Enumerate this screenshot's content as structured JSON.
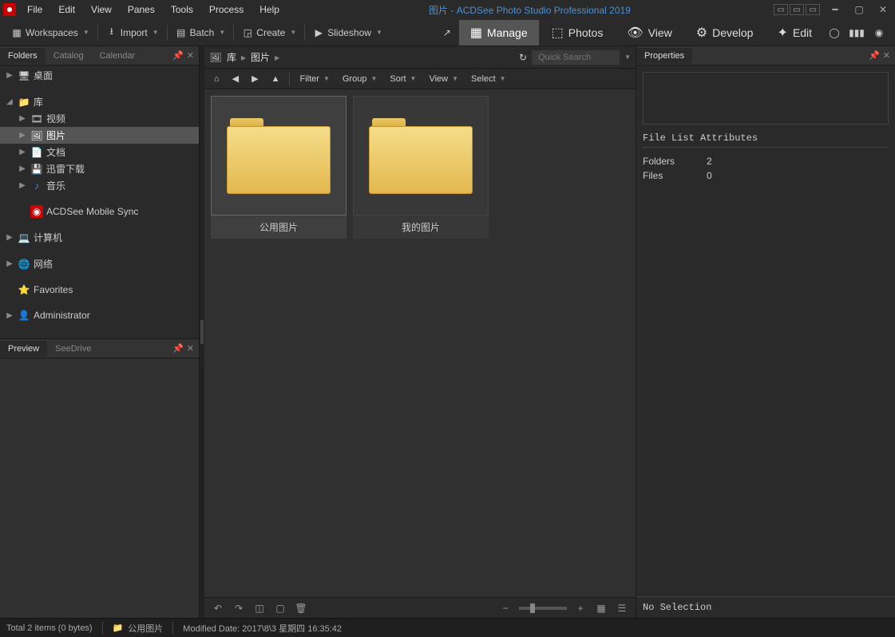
{
  "title": "图片 - ACDSee Photo Studio Professional 2019",
  "menu": [
    "File",
    "Edit",
    "View",
    "Panes",
    "Tools",
    "Process",
    "Help"
  ],
  "toolbar": {
    "workspaces": "Workspaces",
    "import": "Import",
    "batch": "Batch",
    "create": "Create",
    "slideshow": "Slideshow"
  },
  "modes": {
    "manage": "Manage",
    "photos": "Photos",
    "view": "View",
    "develop": "Develop",
    "edit": "Edit"
  },
  "left": {
    "tabs": {
      "folders": "Folders",
      "catalog": "Catalog",
      "calendar": "Calendar"
    },
    "tree": {
      "desktop": "桌面",
      "library": "库",
      "videos": "视频",
      "pictures": "图片",
      "documents": "文档",
      "downloads": "迅雷下载",
      "music": "音乐",
      "mobile": "ACDSee Mobile Sync",
      "computer": "计算机",
      "network": "网络",
      "favorites": "Favorites",
      "admin": "Administrator"
    },
    "preview_tabs": {
      "preview": "Preview",
      "seedrive": "SeeDrive"
    }
  },
  "breadcrumb": {
    "root": "库",
    "current": "图片"
  },
  "search_placeholder": "Quick Search",
  "filterbar": {
    "filter": "Filter",
    "group": "Group",
    "sort": "Sort",
    "view": "View",
    "select": "Select"
  },
  "files": [
    {
      "name": "公用图片"
    },
    {
      "name": "我的图片"
    }
  ],
  "right": {
    "title": "Properties",
    "section": "File List Attributes",
    "folders_label": "Folders",
    "folders_value": "2",
    "files_label": "Files",
    "files_value": "0",
    "no_selection": "No Selection"
  },
  "status": {
    "total": "Total 2 items  (0 bytes)",
    "selected_name": "公用图片",
    "modified": "Modified Date: 2017\\8\\3 星期四 16:35:42"
  }
}
